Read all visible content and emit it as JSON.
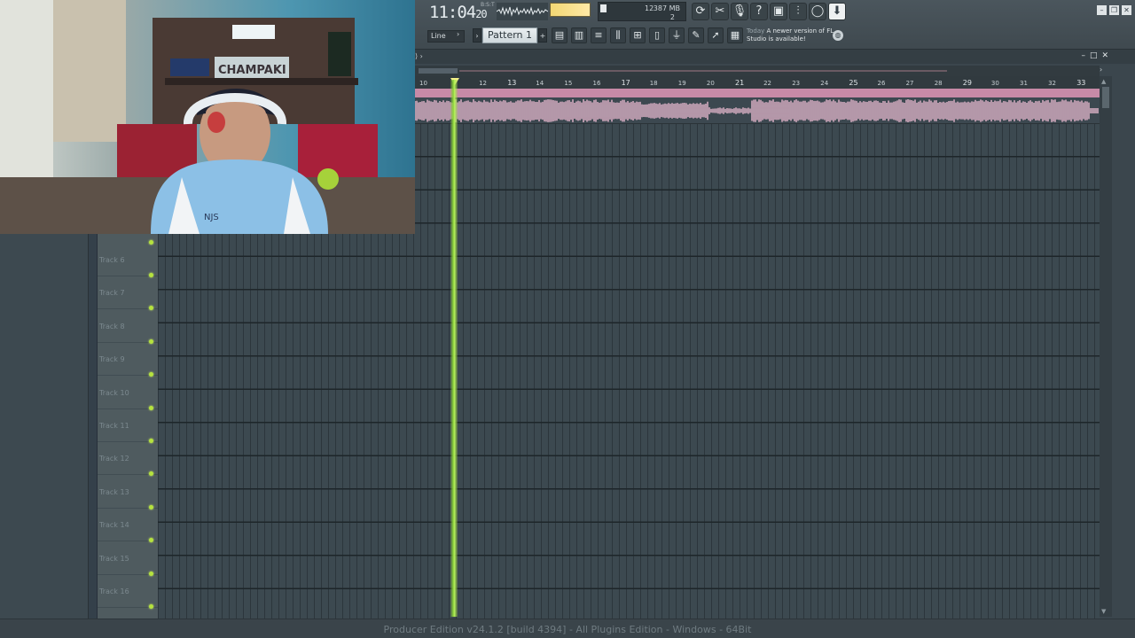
{
  "toolbar": {
    "clock_main": "11:04",
    "clock_sub": "20",
    "clock_beat": "B:S:T",
    "cpu_value": "12",
    "memory": "387 MB",
    "polyphony": "2",
    "snap_label": "Line",
    "pattern_label": "Pattern 1",
    "news_today": "Today",
    "news_text": "A newer version of FL Studio is available!"
  },
  "playlist": {
    "crumb": "⟩ ›",
    "timeline_labels": [
      "10",
      "12",
      "13",
      "14",
      "15",
      "16",
      "17",
      "18",
      "19",
      "20",
      "21",
      "22",
      "23",
      "24",
      "25",
      "26",
      "27",
      "28",
      "29",
      "30",
      "31",
      "32",
      "33"
    ],
    "tracks": [
      "Track 6",
      "Track 7",
      "Track 8",
      "Track 9",
      "Track 10",
      "Track 11",
      "Track 12",
      "Track 13",
      "Track 14",
      "Track 15",
      "Track 16"
    ]
  },
  "status": {
    "text": "Producer Edition v24.1.2 [build 4394] - All Plugins Edition - Windows - 64Bit"
  },
  "webcam": {
    "sign_text": "CHAMPAKI",
    "shirt_text": "NJS"
  },
  "colors": {
    "accent_green": "#b5e23e",
    "waveform_pink": "#e8b9cf",
    "playhead": "#8ad03a"
  }
}
